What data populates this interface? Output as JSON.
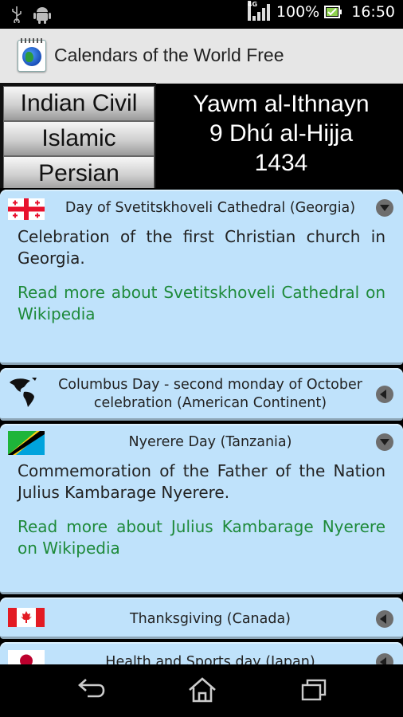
{
  "status_bar": {
    "network_type": "4G",
    "battery": "100%",
    "time": "16:50",
    "icons": [
      "usb-icon",
      "android-icon",
      "signal-icon",
      "battery-icon"
    ]
  },
  "app": {
    "title": "Calendars of the World Free",
    "icon": "globe-calendar-icon"
  },
  "calendar_picker": [
    "Indian Civil",
    "Islamic",
    "Persian"
  ],
  "date": {
    "line1": "Yawm al-Ithnayn",
    "line2": "9 Dhú al-Hijja",
    "line3": "1434"
  },
  "events": [
    {
      "flag": "georgia-flag-icon",
      "title": "Day of Svetitskhoveli Cathedral (Georgia)",
      "expanded": true,
      "description": "Celebration of the first Christian church in Georgia.",
      "link": "Read more about Svetitskhoveli Cathedral on Wikipedia"
    },
    {
      "flag": "americas-map-icon",
      "title": "Columbus Day - second monday of October celebration (American Continent)",
      "expanded": false
    },
    {
      "flag": "tanzania-flag-icon",
      "title": "Nyerere Day (Tanzania)",
      "expanded": true,
      "description": "Commemoration of the Father of the Nation Julius Kambarage Nyerere.",
      "link": "Read more about Julius Kambarage Nyerere on Wikipedia"
    },
    {
      "flag": "canada-flag-icon",
      "title": "Thanksgiving (Canada)",
      "expanded": false
    },
    {
      "flag": "japan-flag-icon",
      "title": "Health and Sports day (Japan)",
      "expanded": false
    }
  ],
  "nav": [
    "back-icon",
    "home-icon",
    "recents-icon"
  ],
  "colors": {
    "card": "#bfe2fb",
    "link": "#1e8a3a",
    "actionbar": "#e6e6e6"
  }
}
